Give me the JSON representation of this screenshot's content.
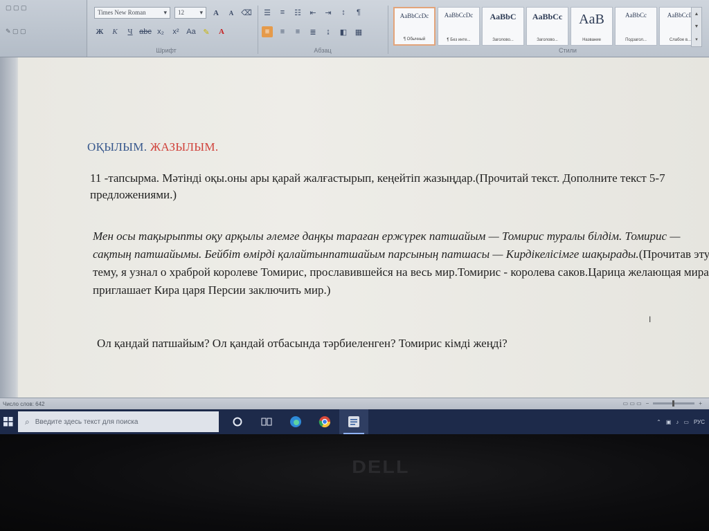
{
  "ribbon": {
    "font_name": "Times New Roman",
    "font_size": "12",
    "groups": {
      "font": "Шрифт",
      "paragraph": "Абзац",
      "styles": "Стили"
    },
    "styles": [
      {
        "preview": "AaBbCcDc",
        "name": "¶ Обычный",
        "kind": "small",
        "active": true
      },
      {
        "preview": "AaBbCcDc",
        "name": "¶ Без инте...",
        "kind": "small"
      },
      {
        "preview": "AaBbC",
        "name": "Заголово...",
        "kind": "mid"
      },
      {
        "preview": "AaBbCc",
        "name": "Заголово...",
        "kind": "mid"
      },
      {
        "preview": "AaB",
        "name": "Название",
        "kind": "big"
      },
      {
        "preview": "AaBbCc",
        "name": "Подзагол...",
        "kind": "small"
      },
      {
        "preview": "AaBbCcD",
        "name": "Слабое в...",
        "kind": "small"
      }
    ]
  },
  "document": {
    "heading_part1": "ОҚЫЛЫМ.",
    "heading_part2": "ЖАЗЫЛЫМ.",
    "para1": "11 -тапсырма. Мәтінді оқы.оны ары қарай жалғастырып, кеңейтіп  жазыңдар.(Прочитай текст. Дополните  текст  5-7 предложениями.)",
    "para2_kz": "Мен осы тақырыпты оқу арқылы әлемге даңқы тараған ержүрек патшайым — Томирис туралы білдім. Томирис — сақтың   патшайымы. Бейбіт өмірді қалайтынпатшайым парсының патшасы — Кирдікелісімге шақырады.",
    "para2_ru": "(Прочитав эту тему, я узнал о храброй королеве Томирис, прославившейся на весь мир.Томирис - королева саков.Царица желающая мира приглашает Кира царя Персии заключить мир.)",
    "para3": "Ол қандай патшайым?  Ол қандай отбасында тәрбиеленген? Томирис кімді жеңді?"
  },
  "statusbar": {
    "left_text": "Число слов: 642"
  },
  "taskbar": {
    "search_placeholder": "Введите здесь текст для поиска",
    "tray_lang": "РУС"
  },
  "bezel": {
    "brand": "DELL"
  }
}
